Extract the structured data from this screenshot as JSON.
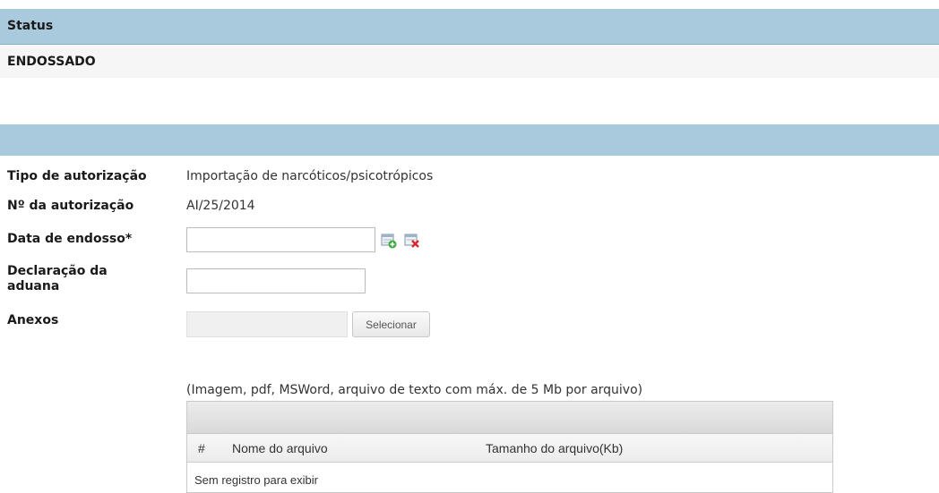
{
  "status": {
    "header_label": "Status",
    "value": "ENDOSSADO"
  },
  "form": {
    "fields": {
      "tipo": {
        "label": "Tipo de autorização",
        "value": "Importação de narcóticos/psicotrópicos"
      },
      "numero": {
        "label": "Nº da autorização",
        "value": "AI/25/2014"
      },
      "data_endosso": {
        "label": "Data de endosso*",
        "value": ""
      },
      "declaracao": {
        "label_line1": "Declaração da",
        "label_line2": "aduana",
        "value": ""
      },
      "anexos": {
        "label": "Anexos",
        "select_label": "Selecionar"
      }
    },
    "icons": [
      "calendar-add-icon",
      "clear-date-icon"
    ],
    "hint": "(Imagem, pdf, MSWord, arquivo de texto com máx. de 5 Mb por arquivo)"
  },
  "grid": {
    "columns": [
      "#",
      "Nome do arquivo",
      "Tamanho do arquivo(Kb)"
    ],
    "empty_text": "Sem registro para exibir"
  }
}
